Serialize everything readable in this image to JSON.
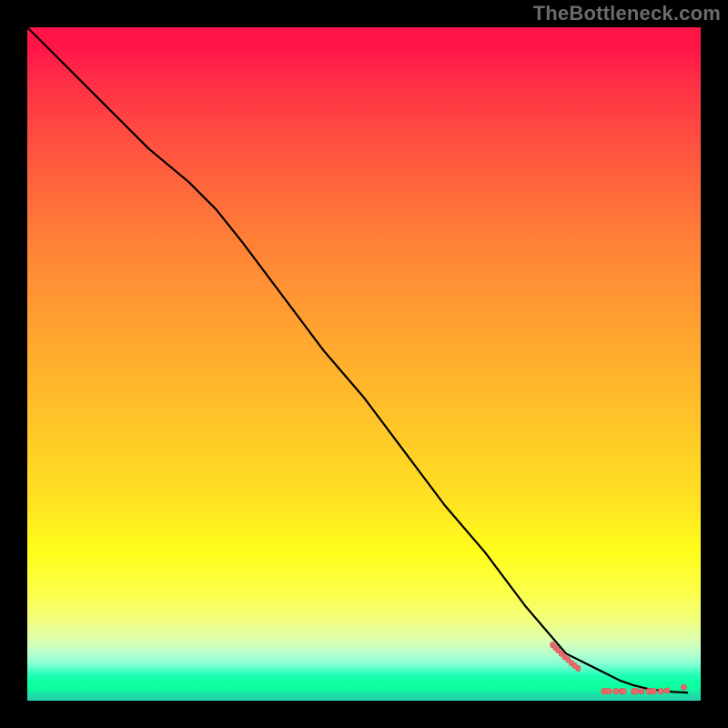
{
  "watermark": "TheBottleneck.com",
  "colors": {
    "background": "#000000",
    "curve": "#000000",
    "marker": "#e86a6a",
    "gradient_top": "#ff1548",
    "gradient_mid": "#ffe122",
    "gradient_bottom": "#13ffa8"
  },
  "chart_data": {
    "type": "line",
    "title": "",
    "xlabel": "",
    "ylabel": "",
    "xlim": [
      0,
      100
    ],
    "ylim": [
      0,
      100
    ],
    "grid": false,
    "legend": false,
    "series": [
      {
        "name": "curve",
        "x": [
          0,
          6,
          12,
          18,
          24,
          28,
          32,
          38,
          44,
          50,
          56,
          62,
          68,
          74,
          80,
          82,
          84,
          86,
          88,
          90,
          92,
          94,
          96,
          98
        ],
        "y": [
          100,
          94,
          88,
          82,
          77,
          73,
          68,
          60,
          52,
          45,
          37,
          29,
          22,
          14,
          7,
          6,
          5,
          4,
          3,
          2.3,
          1.8,
          1.5,
          1.3,
          1.2
        ]
      }
    ],
    "markers": {
      "name": "points",
      "comment": "Salmon dots/bars near the bottom-right; y is approximate % of plot height from bottom",
      "points": [
        {
          "x": 78.0,
          "y": 8.3
        },
        {
          "x": 78.4,
          "y": 7.9
        },
        {
          "x": 78.8,
          "y": 7.5
        },
        {
          "x": 79.3,
          "y": 7.0
        },
        {
          "x": 79.8,
          "y": 6.5
        },
        {
          "x": 80.3,
          "y": 6.1
        },
        {
          "x": 80.8,
          "y": 5.6
        },
        {
          "x": 81.3,
          "y": 5.2
        },
        {
          "x": 81.8,
          "y": 4.8
        },
        {
          "x": 85.6,
          "y": 1.4
        },
        {
          "x": 86.0,
          "y": 1.4
        },
        {
          "x": 86.4,
          "y": 1.4
        },
        {
          "x": 87.4,
          "y": 1.4
        },
        {
          "x": 88.2,
          "y": 1.4
        },
        {
          "x": 88.6,
          "y": 1.4
        },
        {
          "x": 90.0,
          "y": 1.4
        },
        {
          "x": 90.4,
          "y": 1.4
        },
        {
          "x": 91.2,
          "y": 1.4
        },
        {
          "x": 92.3,
          "y": 1.4
        },
        {
          "x": 92.7,
          "y": 1.4
        },
        {
          "x": 93.1,
          "y": 1.4
        },
        {
          "x": 94.1,
          "y": 1.4
        },
        {
          "x": 95.0,
          "y": 1.5
        },
        {
          "x": 97.5,
          "y": 2.0
        }
      ]
    }
  }
}
